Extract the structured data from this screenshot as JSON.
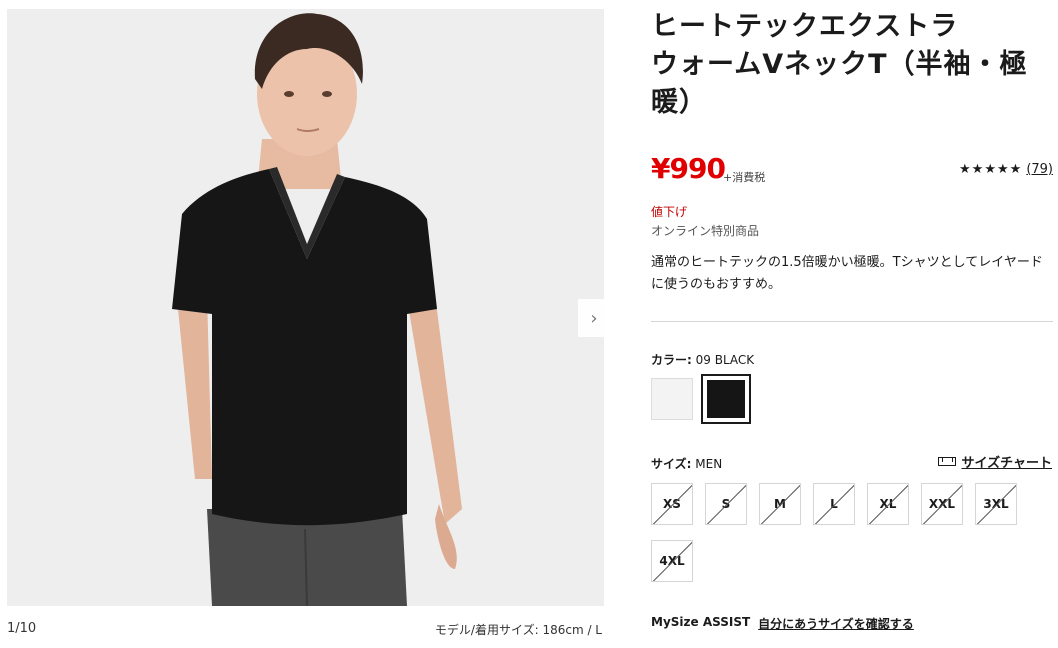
{
  "gallery": {
    "counter": "1/10",
    "model_info": "モデル/着用サイズ: 186cm / L",
    "next_icon": "chevron-right-icon"
  },
  "product": {
    "title_lines": [
      "ヒートテックエクストラ",
      "ウォームVネックT（半袖・極",
      "暖）"
    ],
    "price": "¥990",
    "tax_note": "+消費税",
    "rating": {
      "stars": "★★★★★",
      "count": "(79)",
      "value": 4.5
    },
    "sale_label": "値下げ",
    "online_label": "オンライン特別商品",
    "description": "通常のヒートテックの1.5倍暖かい極暖。Tシャツとしてレイヤードに使うのもおすすめ。"
  },
  "color": {
    "label": "カラー:",
    "value": "09 BLACK",
    "swatches": [
      {
        "name": "white",
        "hex": "#f3f3f3"
      },
      {
        "name": "black",
        "hex": "#151515",
        "selected": true
      }
    ]
  },
  "size": {
    "label": "サイズ:",
    "value": "MEN",
    "chart_link": "サイズチャート",
    "options": [
      "XS",
      "S",
      "M",
      "L",
      "XL",
      "XXL",
      "3XL",
      "4XL"
    ]
  },
  "mysize": {
    "label": "MySize ASSIST",
    "link": "自分にあうサイズを確認する"
  },
  "colors": {
    "price_red": "#e00000",
    "sale_red": "#c00000",
    "text": "#1b1b1b"
  }
}
